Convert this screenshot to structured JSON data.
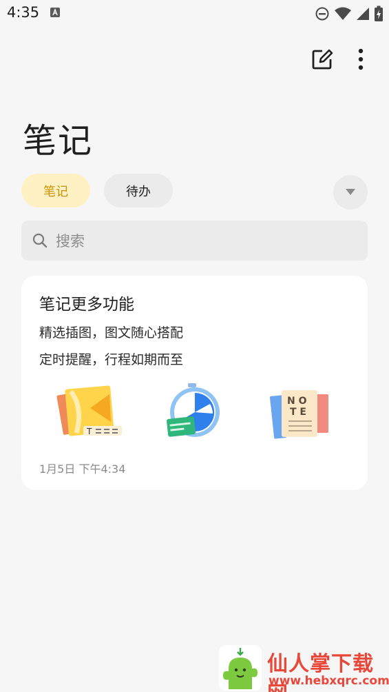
{
  "status_bar": {
    "time": "4:35",
    "icons": [
      "a-keyboard-icon",
      "dnd-icon",
      "wifi-icon",
      "signal-icon",
      "battery-icon"
    ]
  },
  "toolbar": {
    "icons": [
      "edit-icon",
      "more-vertical-icon"
    ]
  },
  "page": {
    "title": "笔记"
  },
  "tabs": [
    {
      "label": "笔记",
      "active": true
    },
    {
      "label": "待办",
      "active": false
    }
  ],
  "search": {
    "placeholder": "搜索"
  },
  "note_card": {
    "title": "笔记更多功能",
    "lines": [
      "精选插图，图文随心搭配",
      "定时提醒，行程如期而至"
    ],
    "illustrations": [
      "image-text-illustration",
      "reminder-clock-illustration",
      "note-book-illustration"
    ],
    "date": "1月5日  下午4:34"
  },
  "watermark": {
    "title": "仙人掌下载网",
    "url": "www.hebxqrc.com"
  },
  "colors": {
    "background": "#f6f6f6",
    "accent": "#c99400",
    "accent_bg": "#fff1c4",
    "watermark": "#e8483a"
  }
}
